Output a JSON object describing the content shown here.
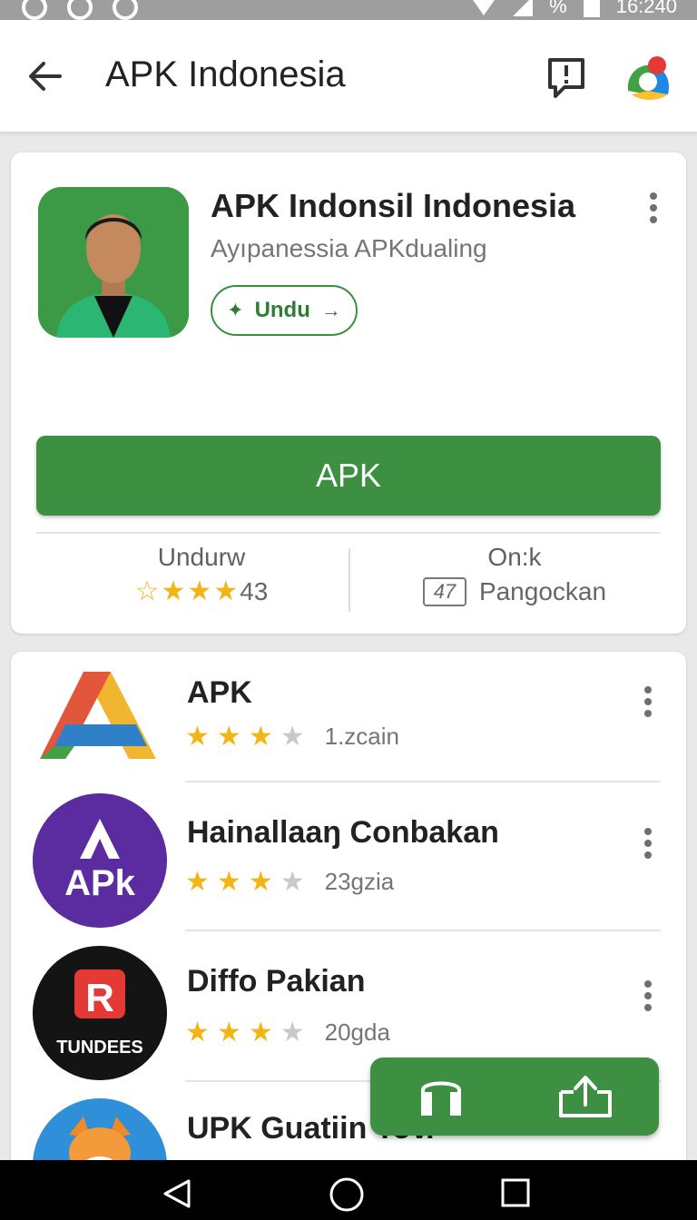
{
  "status_bar": {
    "time": "16:240",
    "battery": "%"
  },
  "app_bar": {
    "title": "APK Indonesia"
  },
  "hero": {
    "name": "APK Indonsil  Indonesia",
    "developer": "Ayıpanessia APKdualing",
    "chip_label": "Undu",
    "primary_label": "APK",
    "stat_left_label": "Undurw",
    "stat_left_value": "43",
    "stat_left_rating": 3,
    "stat_right_label": "On:k",
    "stat_right_badge": "47",
    "stat_right_value": "Pangockan"
  },
  "list": {
    "items": [
      {
        "name": "APK",
        "meta": "1.zcain",
        "rating": 3.5
      },
      {
        "name": "Hainallaaŋ Conbakan",
        "meta": "23gzia",
        "rating": 3.5,
        "icon_text": "APk"
      },
      {
        "name": "Diffo Pakian",
        "meta": "20gda",
        "rating": 3.5,
        "icon_text": "TUNDEES",
        "icon_letter": "R"
      },
      {
        "name": "UPK Guatiin Tov.",
        "meta": "",
        "rating": 0
      }
    ]
  },
  "colors": {
    "primary": "#3d8f41",
    "star": "#f3b515",
    "purple": "#5a2ca0"
  },
  "icons": [
    "back-arrow-icon",
    "feedback-icon",
    "account-icon",
    "more-vert-icon",
    "star-icon",
    "shopping-bag-icon",
    "share-icon",
    "nav-back-icon",
    "nav-home-icon",
    "nav-recent-icon"
  ]
}
